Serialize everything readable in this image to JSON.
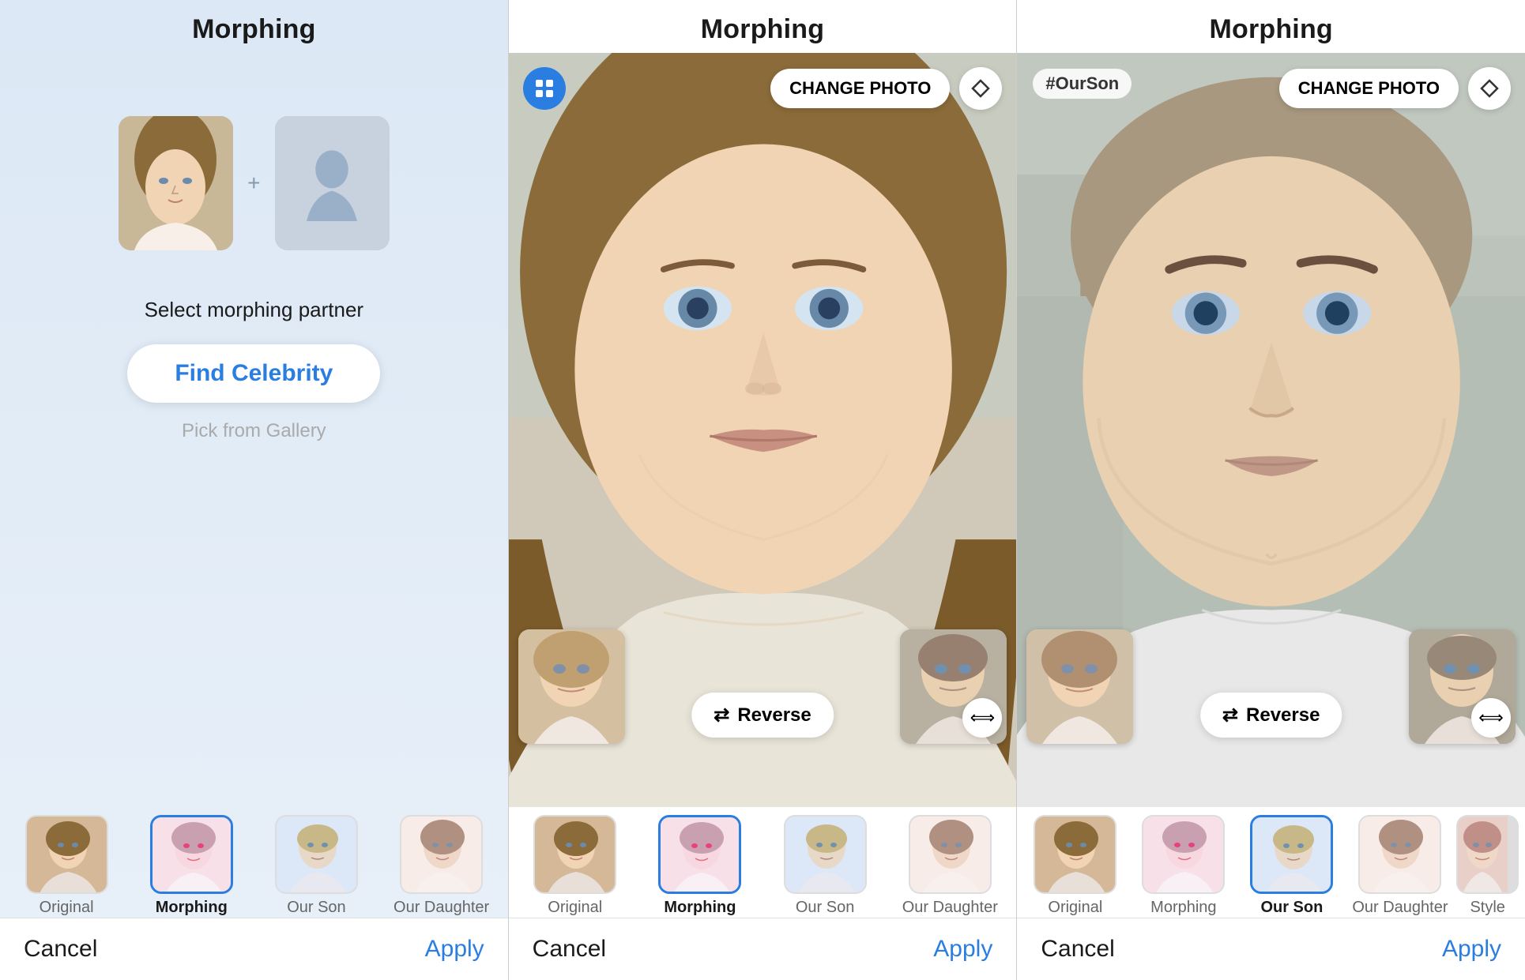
{
  "panels": [
    {
      "id": "panel-1",
      "header": "Morphing",
      "body": {
        "select_label": "Select morphing partner",
        "find_celebrity_btn": "Find Celebrity",
        "gallery_link": "Pick from Gallery"
      },
      "tabs": [
        {
          "label": "Original",
          "active": false
        },
        {
          "label": "Morphing",
          "active": true
        },
        {
          "label": "Our Son",
          "active": false
        },
        {
          "label": "Our Daughter",
          "active": false
        }
      ],
      "footer": {
        "cancel": "Cancel",
        "apply": "Apply"
      }
    },
    {
      "id": "panel-2",
      "header": "Morphing",
      "toolbar": {
        "change_photo": "CHANGE PHOTO"
      },
      "reverse_btn": "Reverse",
      "tabs": [
        {
          "label": "Original",
          "active": false
        },
        {
          "label": "Morphing",
          "active": true
        },
        {
          "label": "Our Son",
          "active": false
        },
        {
          "label": "Our Daughter",
          "active": false
        }
      ],
      "footer": {
        "cancel": "Cancel",
        "apply": "Apply"
      }
    },
    {
      "id": "panel-3",
      "header": "Morphing",
      "toolbar": {
        "change_photo": "CHANGE PHOTO"
      },
      "hashtag": "#OurSon",
      "reverse_btn": "Reverse",
      "tabs": [
        {
          "label": "Original",
          "active": false
        },
        {
          "label": "Morphing",
          "active": false
        },
        {
          "label": "Our Son",
          "active": true
        },
        {
          "label": "Our Daughter",
          "active": false
        },
        {
          "label": "Style",
          "active": false
        }
      ],
      "footer": {
        "cancel": "Cancel",
        "apply": "Apply"
      }
    }
  ],
  "icons": {
    "grid": "⊞",
    "erase": "◇",
    "reverse": "⇄",
    "expand": "⟺"
  }
}
